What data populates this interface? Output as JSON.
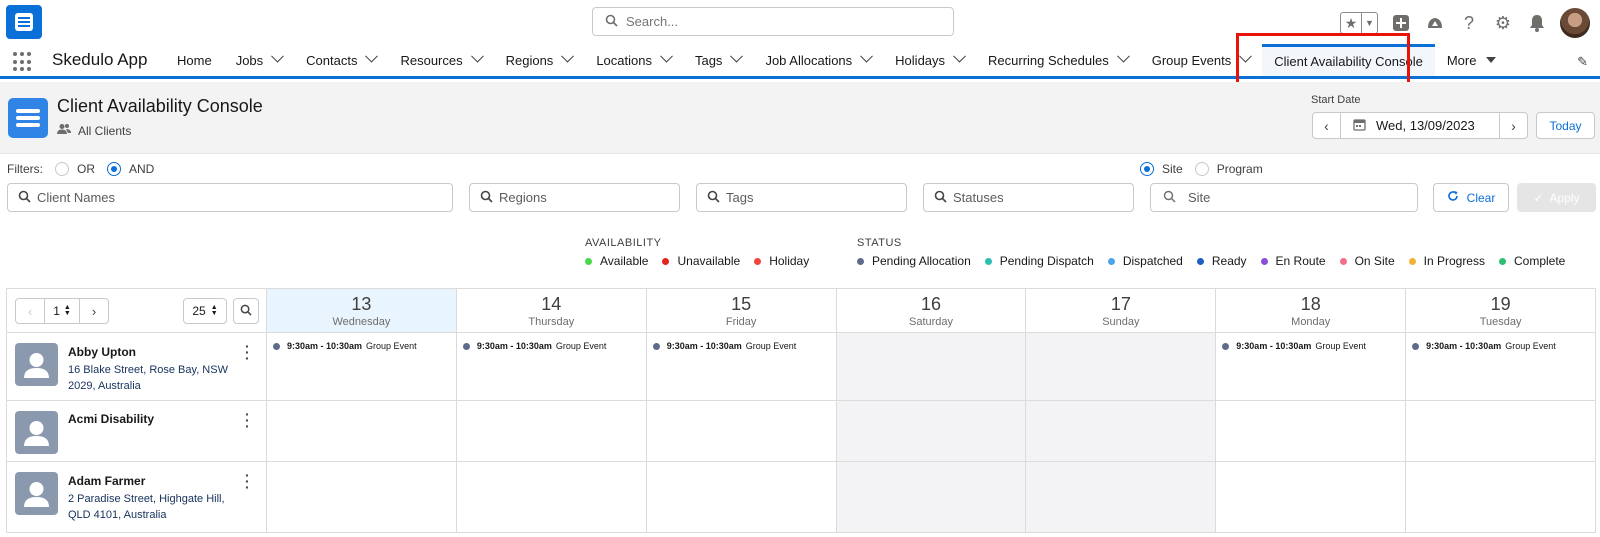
{
  "topbar": {
    "search_placeholder": "Search..."
  },
  "nav": {
    "app_name": "Skedulo App",
    "items": [
      {
        "label": "Home",
        "has_menu": false
      },
      {
        "label": "Jobs",
        "has_menu": true
      },
      {
        "label": "Contacts",
        "has_menu": true
      },
      {
        "label": "Resources",
        "has_menu": true
      },
      {
        "label": "Regions",
        "has_menu": true
      },
      {
        "label": "Locations",
        "has_menu": true
      },
      {
        "label": "Tags",
        "has_menu": true
      },
      {
        "label": "Job Allocations",
        "has_menu": true
      },
      {
        "label": "Holidays",
        "has_menu": true
      },
      {
        "label": "Recurring Schedules",
        "has_menu": true
      },
      {
        "label": "Group Events",
        "has_menu": true
      }
    ],
    "active_label": "Client Availability Console",
    "more_label": "More"
  },
  "header": {
    "title": "Client Availability Console",
    "subtitle": "All Clients",
    "start_date_label": "Start Date",
    "start_date_value": "Wed, 13/09/2023",
    "today_label": "Today"
  },
  "filters": {
    "label": "Filters:",
    "or_label": "OR",
    "and_label": "AND",
    "selected_logic": "AND",
    "site_label": "Site",
    "program_label": "Program",
    "selected_scope": "Site",
    "client_names_placeholder": "Client Names",
    "regions_placeholder": "Regions",
    "tags_placeholder": "Tags",
    "statuses_placeholder": "Statuses",
    "site_placeholder": "Site",
    "clear_label": "Clear",
    "apply_label": "Apply"
  },
  "legend": {
    "availability_title": "AVAILABILITY",
    "availability": [
      {
        "label": "Available",
        "color": "#4bd94b"
      },
      {
        "label": "Unavailable",
        "color": "#e3251b"
      },
      {
        "label": "Holiday",
        "color": "#f0453a"
      }
    ],
    "status_title": "STATUS",
    "status": [
      {
        "label": "Pending Allocation",
        "color": "#5f6b8a"
      },
      {
        "label": "Pending Dispatch",
        "color": "#2bbfb0"
      },
      {
        "label": "Dispatched",
        "color": "#4aa6e8"
      },
      {
        "label": "Ready",
        "color": "#1f5fc4"
      },
      {
        "label": "En Route",
        "color": "#8a4fd6"
      },
      {
        "label": "On Site",
        "color": "#f0708a"
      },
      {
        "label": "In Progress",
        "color": "#f2b233"
      },
      {
        "label": "Complete",
        "color": "#2fbf71"
      }
    ]
  },
  "grid": {
    "page": "1",
    "page_size": "25",
    "days": [
      {
        "num": "13",
        "name": "Wednesday",
        "today": true,
        "weekend": false
      },
      {
        "num": "14",
        "name": "Thursday",
        "today": false,
        "weekend": false
      },
      {
        "num": "15",
        "name": "Friday",
        "today": false,
        "weekend": false
      },
      {
        "num": "16",
        "name": "Saturday",
        "today": false,
        "weekend": true
      },
      {
        "num": "17",
        "name": "Sunday",
        "today": false,
        "weekend": true
      },
      {
        "num": "18",
        "name": "Monday",
        "today": false,
        "weekend": false
      },
      {
        "num": "19",
        "name": "Tuesday",
        "today": false,
        "weekend": false
      }
    ],
    "clients": [
      {
        "name": "Abby Upton",
        "address": "16 Blake Street, Rose Bay, NSW 2029, Australia",
        "events": [
          {
            "time": "9:30am - 10:30am",
            "type": "Group Event"
          },
          {
            "time": "9:30am - 10:30am",
            "type": "Group Event"
          },
          {
            "time": "9:30am - 10:30am",
            "type": "Group Event"
          },
          null,
          null,
          {
            "time": "9:30am - 10:30am",
            "type": "Group Event"
          },
          {
            "time": "9:30am - 10:30am",
            "type": "Group Event"
          }
        ]
      },
      {
        "name": "Acmi Disability",
        "address": "",
        "events": [
          null,
          null,
          null,
          null,
          null,
          null,
          null
        ]
      },
      {
        "name": "Adam Farmer",
        "address": "2 Paradise Street, Highgate Hill, QLD 4101, Australia",
        "events": [
          null,
          null,
          null,
          null,
          null,
          null,
          null
        ]
      }
    ]
  }
}
